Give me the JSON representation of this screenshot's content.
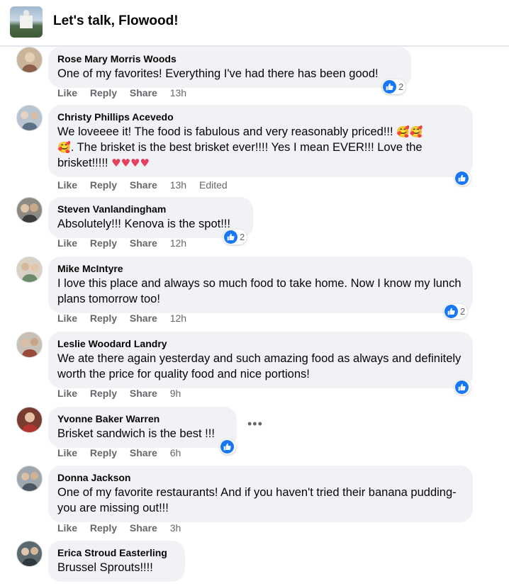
{
  "header": {
    "group_name": "Let's talk, Flowood!",
    "group_thumb_icon": "group-photo-icon"
  },
  "actions": {
    "like": "Like",
    "reply": "Reply",
    "share": "Share",
    "edited": "Edited"
  },
  "more_icon": "more-options-icon",
  "comments": [
    {
      "author": "Rose Mary Morris Woods",
      "text": "One of my favorites! Everything I've had there has been good!",
      "time": "13h",
      "reactions": "2"
    },
    {
      "author": "Christy Phillips Acevedo",
      "text_line1": "We loveeee it! The food is fabulous and very reasonably priced!!!",
      "emoji1": "🥰🥰",
      "emoji2": "🥰",
      "text_line2": ". The brisket is the best brisket ever!!!! Yes I mean EVER!!! Love the",
      "text_line3": "brisket!!!!!",
      "emoji3": "♥♥♥♥",
      "time": "13h",
      "reactions": ""
    },
    {
      "author": "Steven Vanlandingham",
      "text": "Absolutely!!! Kenova is the spot!!!",
      "time": "12h",
      "reactions": "2"
    },
    {
      "author": "Mike McIntyre",
      "text": "I love this place and always so much food to take home. Now I know my lunch plans tomorrow too!",
      "time": "12h",
      "reactions": "2"
    },
    {
      "author": "Leslie Woodard Landry",
      "text": "We ate there again yesterday and such amazing food as always and definitely worth the price for quality food and nice portions!",
      "time": "9h",
      "reactions": ""
    },
    {
      "author": "Yvonne Baker Warren",
      "text": "Brisket sandwich is the best !!!",
      "time": "6h",
      "reactions": ""
    },
    {
      "author": "Donna Jackson",
      "text": "One of my favorite restaurants! And if you haven't tried their banana pudding- you are missing out!!!",
      "time": "3h",
      "reactions": ""
    },
    {
      "author": "Erica Stroud Easterling",
      "text": "Brussel Sprouts!!!!",
      "time": "",
      "reactions": ""
    }
  ]
}
